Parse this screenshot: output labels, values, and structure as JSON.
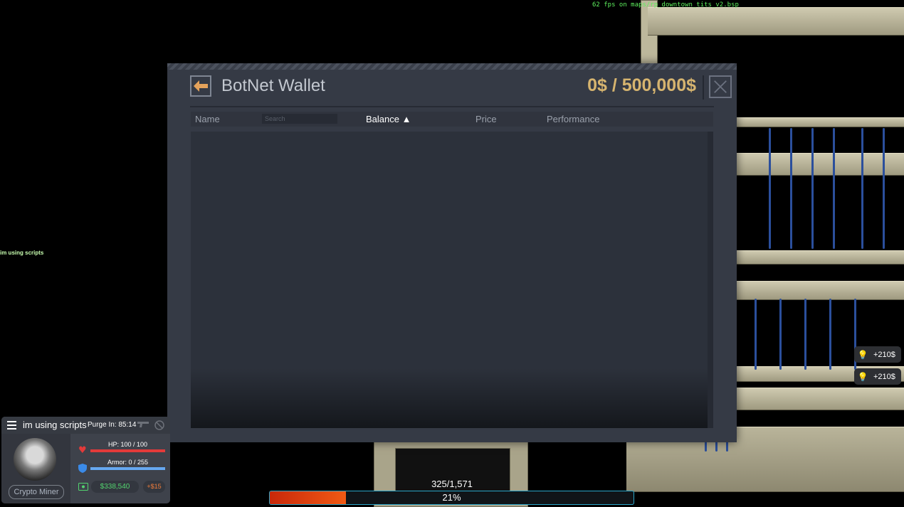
{
  "overlay": {
    "fps_text": "62 fps on maps/rp_downtown_tits_v2.bsp",
    "chat_line": "im using scripts"
  },
  "window": {
    "title": "BotNet Wallet",
    "wallet_text": "0$ / 500,000$",
    "table": {
      "columns": [
        "Name",
        "Balance ▲",
        "Price",
        "Performance"
      ],
      "search_placeholder": "Search",
      "rows": []
    }
  },
  "notifications": [
    {
      "text": "+210$",
      "icon": "lightbulb-icon"
    },
    {
      "text": "+210$",
      "icon": "lightbulb-icon"
    }
  ],
  "hud": {
    "player_name": "im using scripts",
    "purge_text": "Purge  In: 85:14",
    "job": "Crypto Miner",
    "hp_text": "HP: 100 / 100",
    "hp_fraction": 1.0,
    "armor_text": "Armor: 0 / 255",
    "money": "$338,540",
    "salary": "+$15",
    "colors": {
      "hp": "#e33a3a",
      "armor": "#66a8f0",
      "money": "#52d36e",
      "salary": "#f07c3a"
    }
  },
  "progress": {
    "count_text": "325/1,571",
    "percent_text": "21%",
    "fraction": 0.21
  }
}
